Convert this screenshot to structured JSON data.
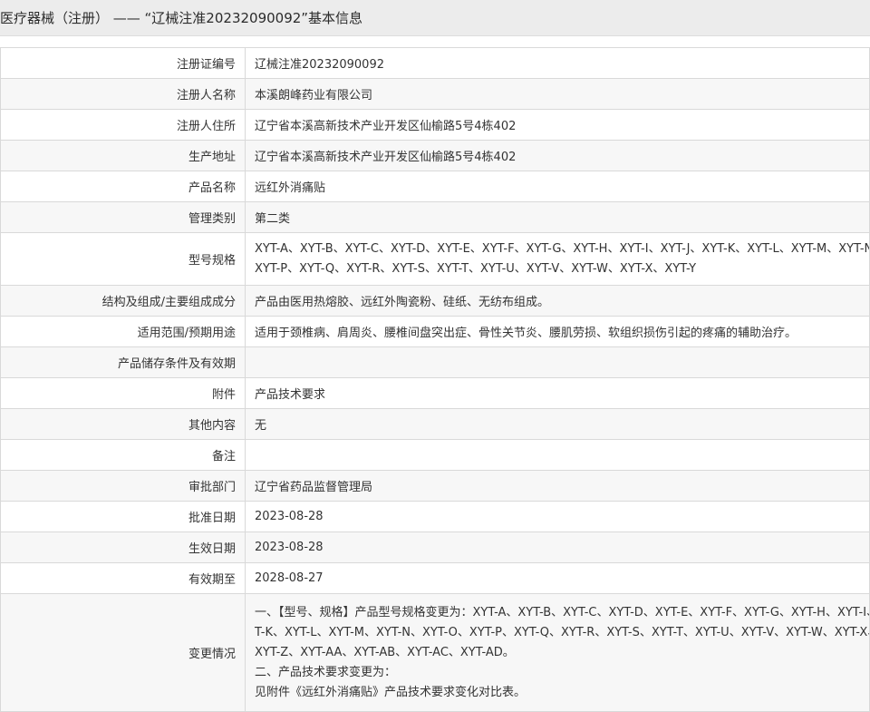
{
  "header": {
    "title": "医疗器械（注册） —— “辽械注准20232090092”基本信息"
  },
  "rows": [
    {
      "label": "注册证编号",
      "value": "辽械注准20232090092"
    },
    {
      "label": "注册人名称",
      "value": "本溪朗峰药业有限公司"
    },
    {
      "label": "注册人住所",
      "value": "辽宁省本溪高新技术产业开发区仙榆路5号4栋402"
    },
    {
      "label": "生产地址",
      "value": "辽宁省本溪高新技术产业开发区仙榆路5号4栋402"
    },
    {
      "label": "产品名称",
      "value": "远红外消痛贴"
    },
    {
      "label": "管理类别",
      "value": "第二类"
    },
    {
      "label": "型号规格",
      "lines": [
        "XYT-A、XYT-B、XYT-C、XYT-D、XYT-E、XYT-F、XYT-G、XYT-H、XYT-I、XYT-J、XYT-K、XYT-L、XYT-M、XYT-N、XYT-O、",
        "XYT-P、XYT-Q、XYT-R、XYT-S、XYT-T、XYT-U、XYT-V、XYT-W、XYT-X、XYT-Y"
      ]
    },
    {
      "label": "结构及组成/主要组成成分",
      "value": "产品由医用热熔胶、远红外陶瓷粉、硅纸、无纺布组成。"
    },
    {
      "label": "适用范围/预期用途",
      "value": "适用于颈椎病、肩周炎、腰椎间盘突出症、骨性关节炎、腰肌劳损、软组织损伤引起的疼痛的辅助治疗。"
    },
    {
      "label": "产品储存条件及有效期",
      "value": ""
    },
    {
      "label": "附件",
      "value": "产品技术要求"
    },
    {
      "label": "其他内容",
      "value": "无"
    },
    {
      "label": "备注",
      "value": ""
    },
    {
      "label": "审批部门",
      "value": "辽宁省药品监督管理局"
    },
    {
      "label": "批准日期",
      "value": "2023-08-28"
    },
    {
      "label": "生效日期",
      "value": "2023-08-28"
    },
    {
      "label": "有效期至",
      "value": "2028-08-27"
    },
    {
      "label": "变更情况",
      "lines": [
        "一、【型号、规格】产品型号规格变更为：XYT-A、XYT-B、XYT-C、XYT-D、XYT-E、XYT-F、XYT-G、XYT-H、XYT-I、XYT-J、XYT-",
        "T-K、XYT-L、XYT-M、XYT-N、XYT-O、XYT-P、XYT-Q、XYT-R、XYT-S、XYT-T、XYT-U、XYT-V、XYT-W、XYT-X、XYT-Y、",
        "XYT-Z、XYT-AA、XYT-AB、XYT-AC、XYT-AD。",
        "二、产品技术要求变更为：",
        "见附件《远红外消痛贴》产品技术要求变化对比表。"
      ]
    }
  ]
}
